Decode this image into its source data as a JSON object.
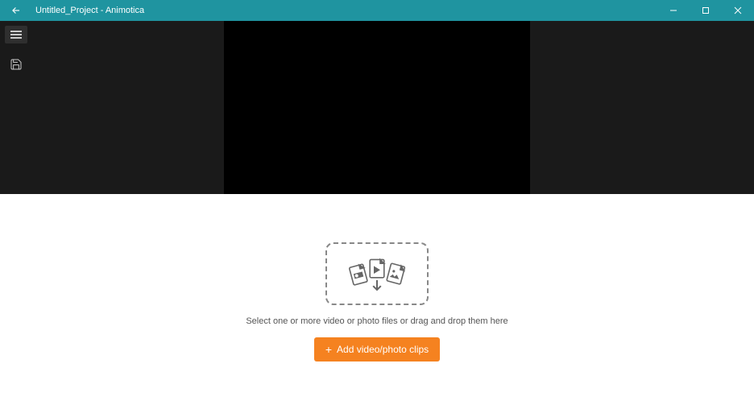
{
  "titlebar": {
    "title": "Untitled_Project - Animotica"
  },
  "sidebar": {
    "menu_icon": "menu-icon",
    "save_icon": "save-icon"
  },
  "dropzone": {
    "hint": "Select one or more video or photo files or drag and drop them here",
    "button_label": "Add video/photo clips"
  },
  "colors": {
    "titlebar": "#1f94a0",
    "accent": "#f58220",
    "dark_bg": "#1a1a1a",
    "light_bg": "#ffffff"
  }
}
